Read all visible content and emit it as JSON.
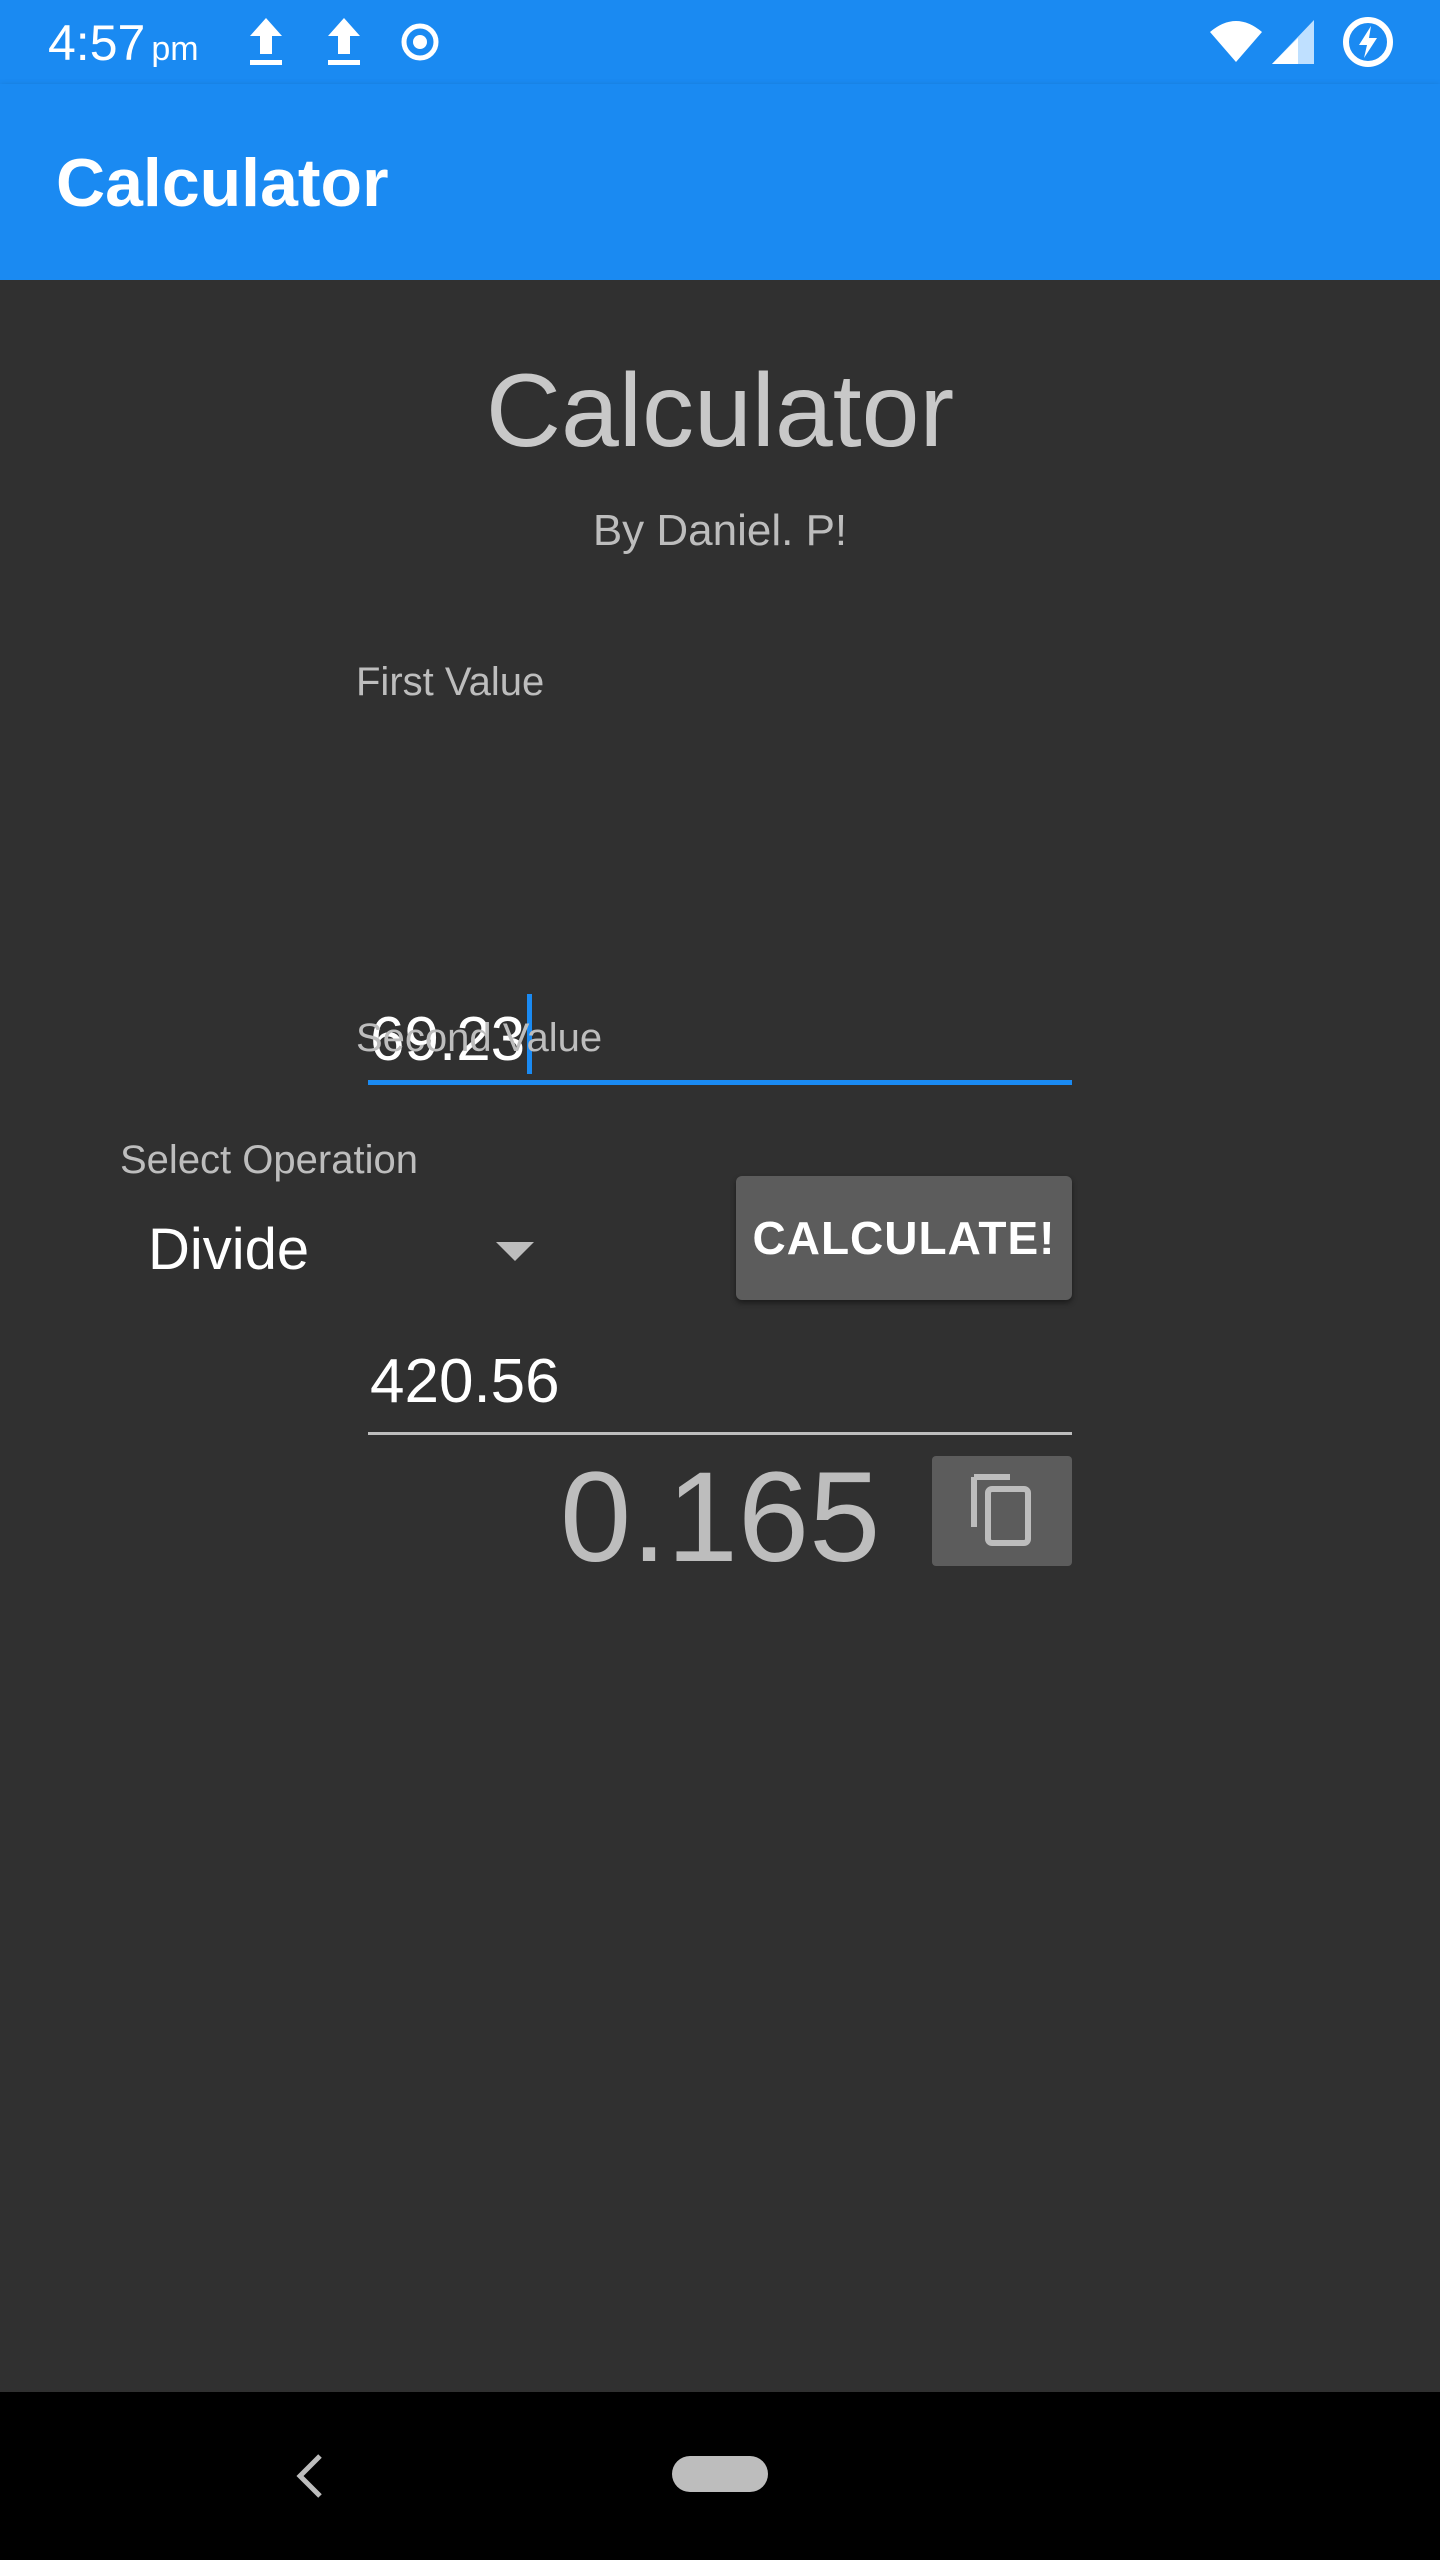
{
  "status_bar": {
    "time": "4:57",
    "ampm": "pm",
    "icons": [
      "upload-icon",
      "upload-icon",
      "record-icon",
      "wifi-icon",
      "signal-icon",
      "battery-saver-icon"
    ]
  },
  "app_bar": {
    "title": "Calculator",
    "color": "#1a8af2"
  },
  "main": {
    "heading": "Calculator",
    "subheading": "By Daniel. P!",
    "first_value": {
      "label": "First Value",
      "value": "69.23"
    },
    "second_value": {
      "label": "Second Value",
      "value": "420.56"
    },
    "operation": {
      "label": "Select Operation",
      "selected": "Divide"
    },
    "calculate_label": "CALCULATE!",
    "result": "0.165"
  },
  "nav_bar": {
    "icons": [
      "back-icon",
      "home-pill-icon"
    ]
  }
}
